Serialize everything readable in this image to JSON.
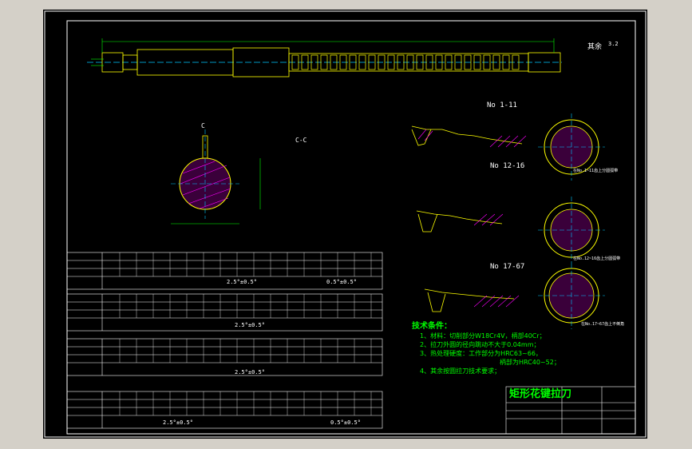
{
  "colors": {
    "background": "#000000",
    "frame": "#ffffff",
    "outline": "#ffff00",
    "hatch": "#ff00ff",
    "center": "#00c8ff",
    "dim": "#00ff00",
    "section_text": "#ffffff",
    "title_text": "#ff00ff",
    "table_text": "#c8c8ff"
  },
  "top_note": "其余",
  "top_rough": "3.2",
  "section_cc": "C-C",
  "section_c": "C",
  "views": {
    "v1": "No 1-11",
    "v2": "No 12-16",
    "v3": "No 17-67"
  },
  "notes": {
    "n1": "在No.1~11齿上分圆弧带",
    "n2": "在No.12~16齿上分圆弧带",
    "n3": "在No.17~67齿上不倒角"
  },
  "tech": {
    "title": "技术条件：",
    "items": [
      "1、材料：切削部分W18Cr4V，柄部40Cr；",
      "2、拉刀外圆的径向跳动不大于0.04mm；",
      "3、热处理硬度：工作部分为HRC63~66，",
      "柄部为HRC40~52；",
      "4、其余按圆拉刀技术要求；"
    ]
  },
  "title_block": {
    "name": "矩形花键拉刀"
  },
  "tables": {
    "t1_label_row1": "2.5°±0.5°",
    "t1_label_row2": "0.5°±0.5°",
    "t2_label": "2.5°±0.5°",
    "t3_label": "2.5°±0.5°",
    "t4_label1": "2.5°±0.5°",
    "t4_label2": "0.5°±0.5°"
  }
}
